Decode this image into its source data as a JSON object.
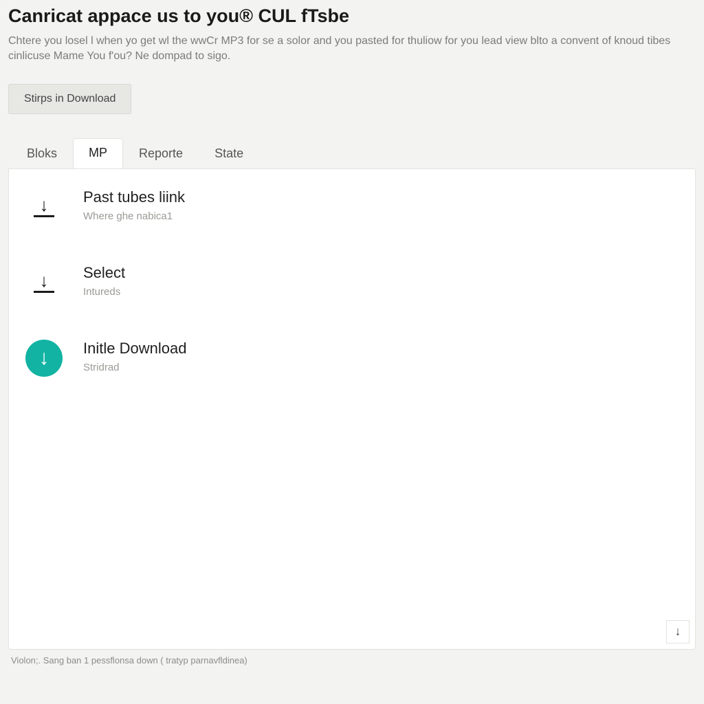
{
  "header": {
    "title": "Canricat appace us to you® CUL fTsbe",
    "subtitle": "Chtere you losel l when yo get wl the wwCr MP3 for se a solor and you pasted for thuliow for you lead view blto a convent of knoud tibes cinlicuse Mame You f'ou? Ne dompad to sigo."
  },
  "buttons": {
    "stepsDownload": "Stirps in Download"
  },
  "tabs": [
    {
      "label": "Bloks",
      "active": false
    },
    {
      "label": "MP",
      "active": true
    },
    {
      "label": "Reporte",
      "active": false
    },
    {
      "label": "State",
      "active": false
    }
  ],
  "steps": [
    {
      "title": "Past tubes liink",
      "sub": "Where ghe nabica1",
      "iconStyle": "plain"
    },
    {
      "title": "Select",
      "sub": "Intureds",
      "iconStyle": "plain"
    },
    {
      "title": "Initle Download",
      "sub": "Stridrad",
      "iconStyle": "circle"
    }
  ],
  "cornerIcon": "↓",
  "footer": "Violon;. Sang ban 1 pessflonsa down ( tratyp parnavfldinea)",
  "colors": {
    "accent": "#12b3a3",
    "pageBg": "#f3f3f1",
    "panelBg": "#ffffff"
  }
}
